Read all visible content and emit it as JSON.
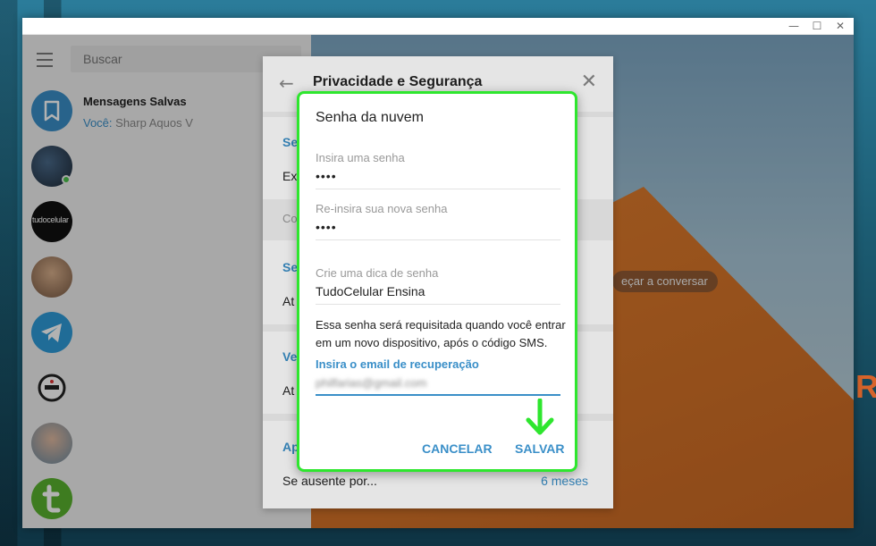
{
  "colors": {
    "accent": "#3a8fc8",
    "highlight_border": "#2ee62e",
    "online": "#4cc34c"
  },
  "window": {
    "controls": [
      "—",
      "☐",
      "✕"
    ]
  },
  "sidebar": {
    "search_placeholder": "Buscar",
    "saved": {
      "title": "Mensagens Salvas",
      "you_label": "Você:",
      "preview": "Sharp Aquos V"
    },
    "avatars": [
      "bookmark-icon",
      "user-avatar",
      "tudocelular-avatar",
      "user-avatar",
      "telegram-icon",
      "logo-avatar",
      "user-avatar",
      "t-logo-avatar"
    ],
    "logo_text": "tudocelular"
  },
  "chat": {
    "start_hint": "eçar a conversar"
  },
  "privacy": {
    "title": "Privacidade e Segurança",
    "rows": [
      {
        "head": "Se",
        "value": "Ex"
      },
      {
        "gray": "Co"
      },
      {
        "head": "Se",
        "value": "At"
      },
      {
        "head": "Ve",
        "value": "At"
      },
      {
        "head": "Ap"
      }
    ],
    "away_label": "Se ausente por...",
    "away_value": "6 meses"
  },
  "dialog": {
    "title": "Senha da nuvem",
    "password_label": "Insira uma senha",
    "password_value": "••••",
    "repeat_label": "Re-insira sua nova senha",
    "repeat_value": "••••",
    "hint_label": "Crie uma dica de senha",
    "hint_value": "TudoCelular Ensina",
    "info": "Essa senha será requisitada quando você entrar em um novo dispositivo, após o código SMS.",
    "recovery_label": "Insira o email de recuperação",
    "recovery_value": "philfarias@gmail.com",
    "cancel_label": "CANCELAR",
    "save_label": "SALVAR"
  },
  "background": {
    "edge_text": "R"
  }
}
